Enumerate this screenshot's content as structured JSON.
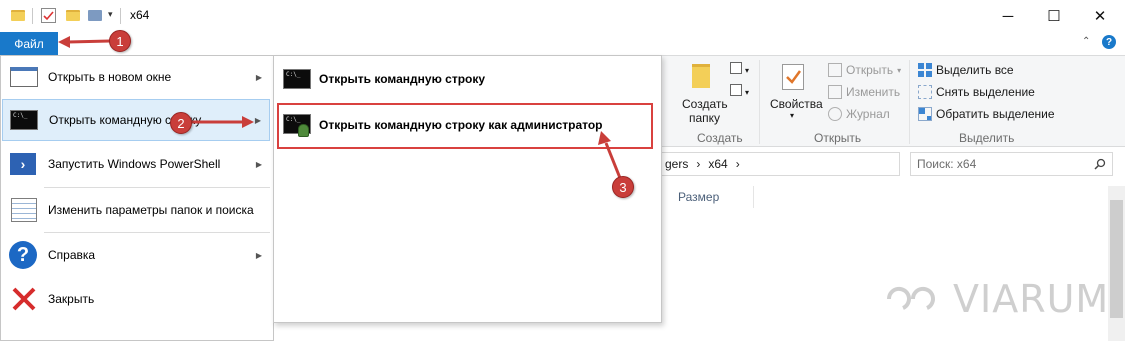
{
  "window": {
    "title": "x64",
    "controls": {
      "minimize": "─",
      "maximize": "☐",
      "close": "✕"
    }
  },
  "ribbon_tabs": {
    "file_tab": "Файл"
  },
  "file_menu": {
    "items": [
      {
        "label": "Открыть в новом окне",
        "icon": "new-window-icon",
        "has_submenu": true
      },
      {
        "label": "Открыть командную строку",
        "icon": "command-prompt-icon",
        "has_submenu": true,
        "highlighted": true
      },
      {
        "label": "Запустить Windows PowerShell",
        "icon": "powershell-icon",
        "has_submenu": true
      },
      {
        "label": "Изменить параметры папок и поиска",
        "icon": "folder-options-icon",
        "has_submenu": false
      },
      {
        "label": "Справка",
        "icon": "help-icon",
        "has_submenu": true
      },
      {
        "label": "Закрыть",
        "icon": "close-icon",
        "has_submenu": false
      }
    ]
  },
  "submenu": {
    "items": [
      {
        "label": "Открыть командную строку",
        "icon": "command-prompt-icon"
      },
      {
        "label": "Открыть командную строку как администратор",
        "icon": "admin-command-prompt-icon",
        "highlighted": true
      }
    ]
  },
  "ribbon": {
    "create_group": {
      "button_label_line1": "Создать",
      "button_label_line2": "папку",
      "group_label": "Создать"
    },
    "open_group": {
      "properties_label": "Свойства",
      "open_label": "Открыть",
      "edit_label": "Изменить",
      "history_label": "Журнал",
      "group_label": "Открыть"
    },
    "select_group": {
      "select_all": "Выделить все",
      "select_none": "Снять выделение",
      "invert": "Обратить выделение",
      "group_label": "Выделить"
    }
  },
  "address_bar": {
    "segments": [
      "gers",
      "x64"
    ],
    "separator": "›"
  },
  "search": {
    "placeholder": "Поиск: x64"
  },
  "columns": {
    "size": "Размер"
  },
  "annotations": {
    "step1": "1",
    "step2": "2",
    "step3": "3",
    "color": "#c93e3a"
  },
  "watermark": "VIARUM"
}
